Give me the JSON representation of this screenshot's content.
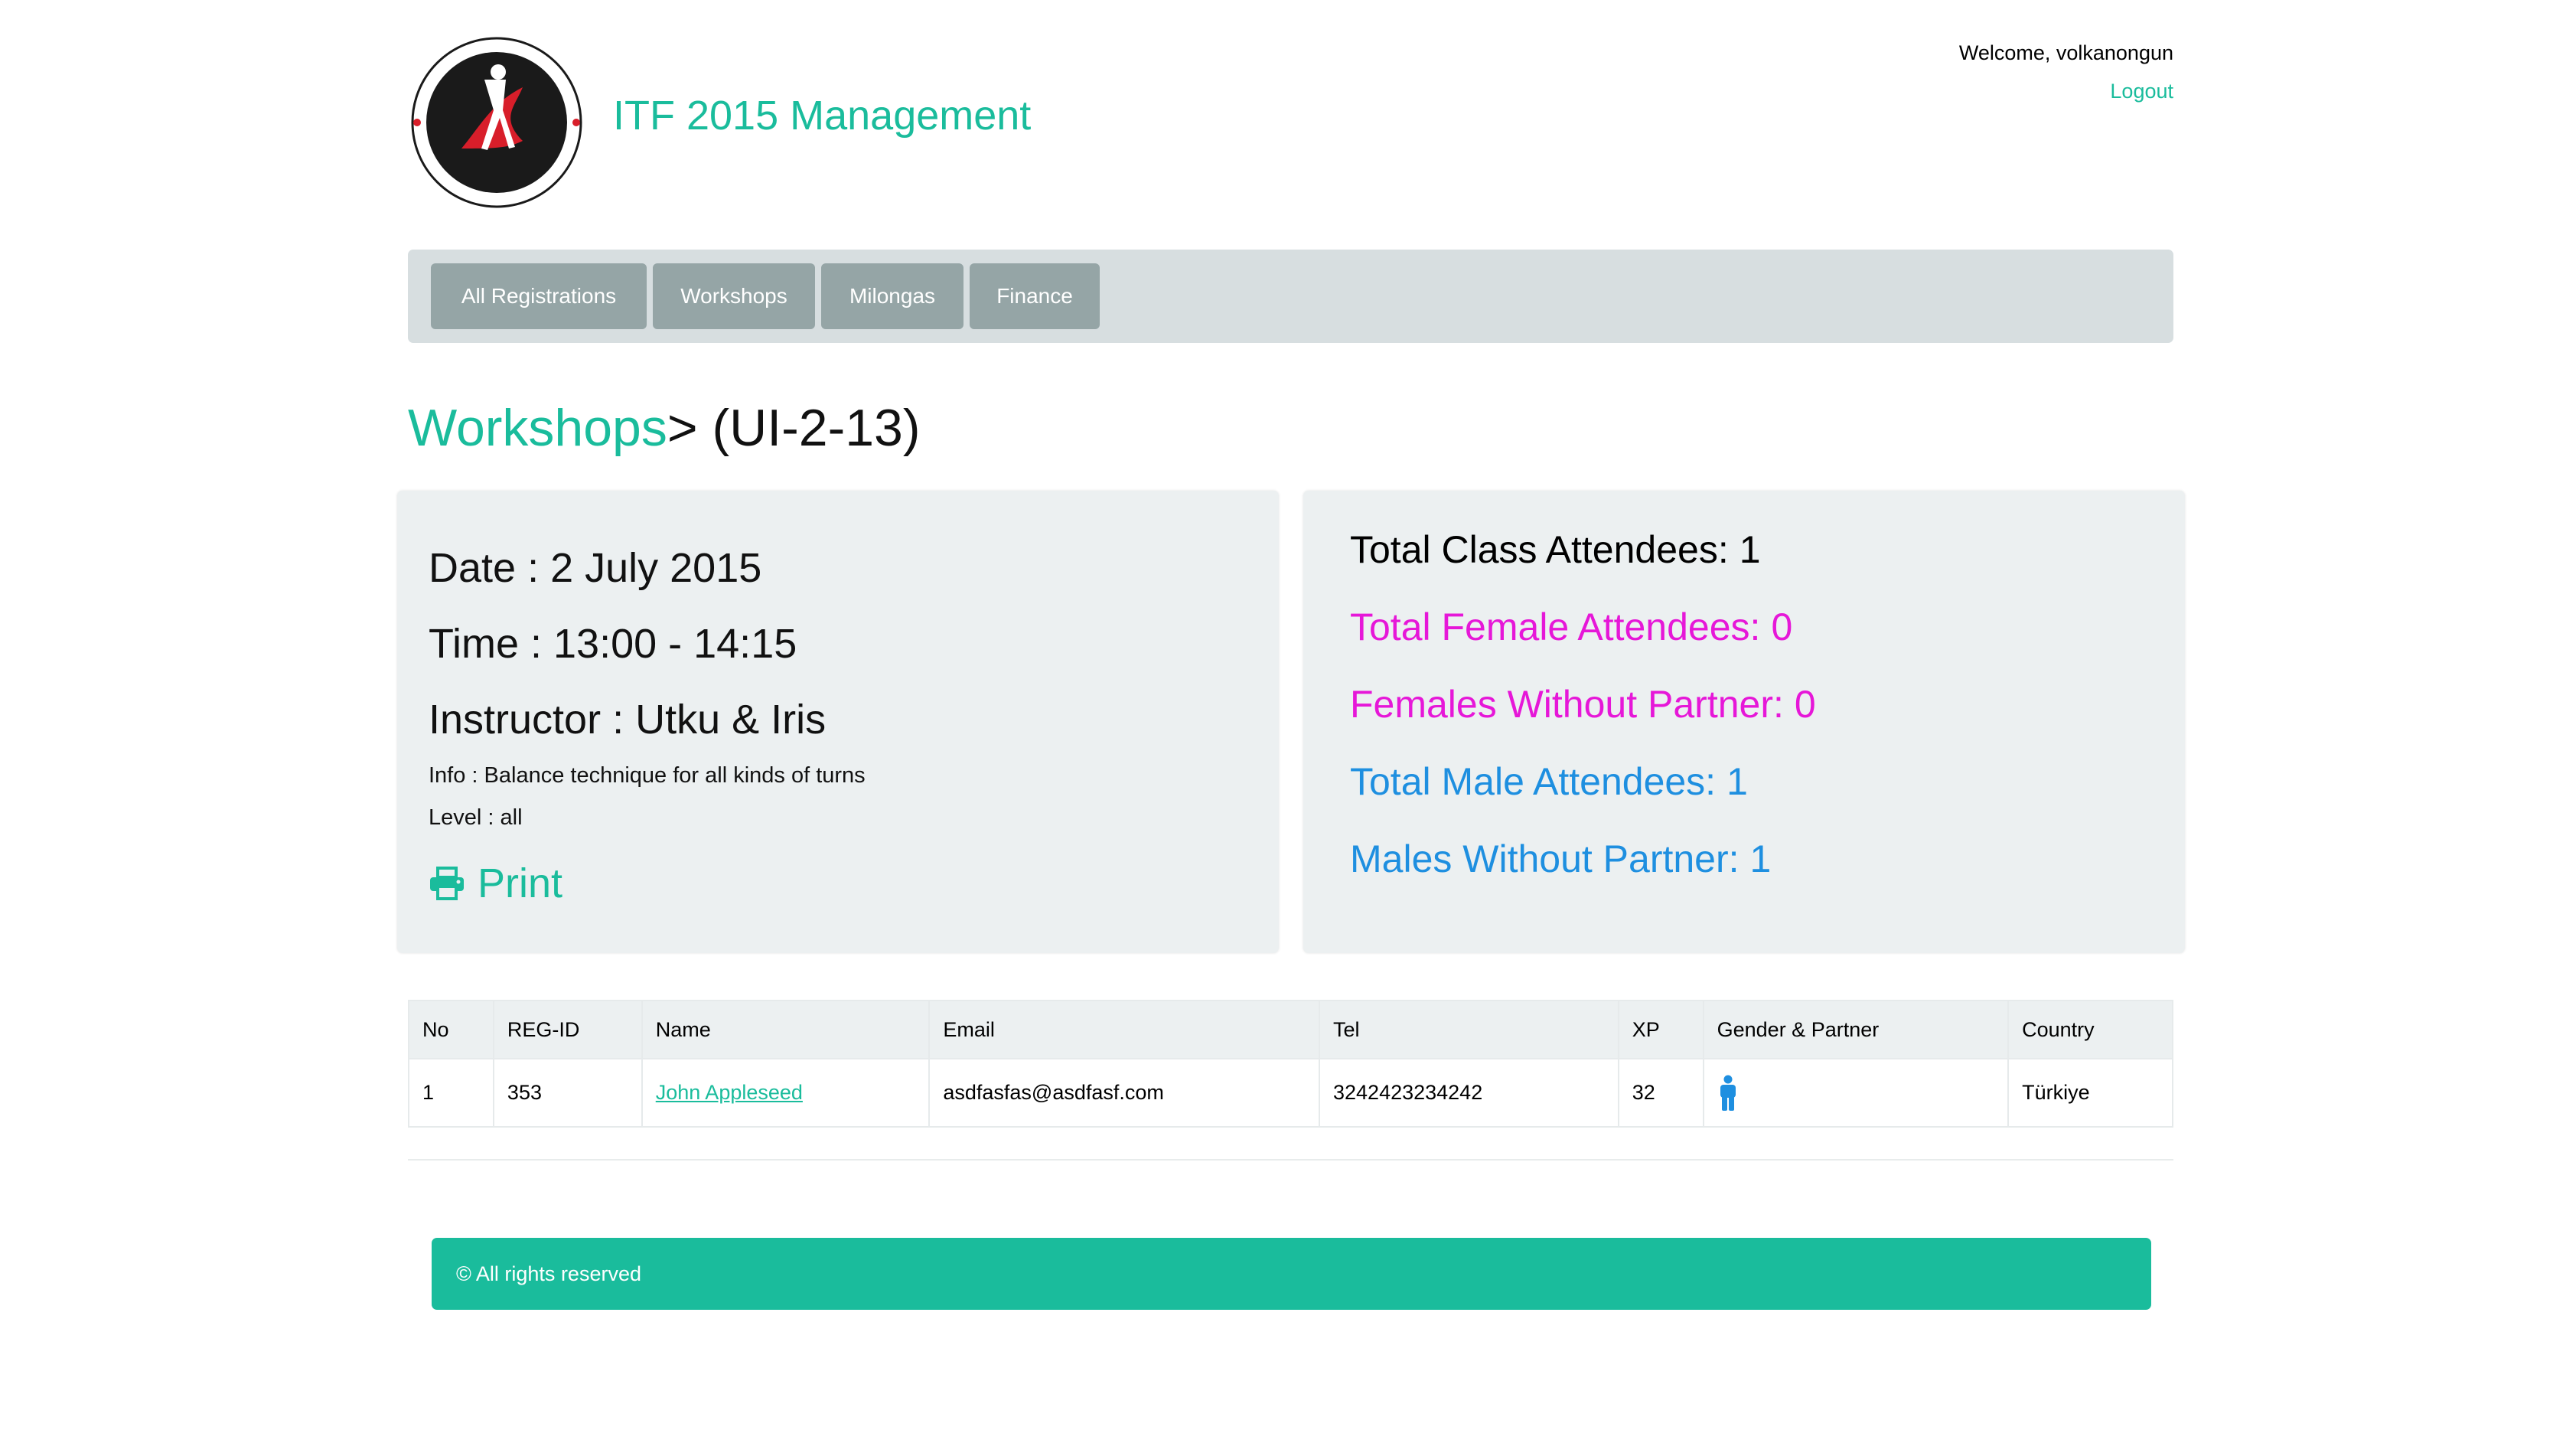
{
  "header": {
    "app_title": "ITF 2015 Management",
    "welcome_text": "Welcome, volkanongun",
    "logout_label": "Logout"
  },
  "nav": {
    "items": [
      {
        "label": "All Registrations"
      },
      {
        "label": "Workshops"
      },
      {
        "label": "Milongas"
      },
      {
        "label": "Finance"
      }
    ]
  },
  "breadcrumb": {
    "link": "Workshops",
    "current": "> (UI-2-13)"
  },
  "details": {
    "date": "Date : 2 July 2015",
    "time": "Time : 13:00 - 14:15",
    "instructor": "Instructor : Utku & Iris",
    "info": "Info : Balance technique for all kinds of turns",
    "level": "Level : all",
    "print_label": "Print"
  },
  "stats": {
    "total_class": {
      "label": "Total Class Attendees:",
      "value": "1",
      "color": "#000000"
    },
    "total_female": {
      "label": "Total Female Attendees:",
      "value": "0",
      "color": "#e617d8"
    },
    "females_without": {
      "label": "Females Without Partner:",
      "value": "0",
      "color": "#e617d8"
    },
    "total_male": {
      "label": "Total Male Attendees:",
      "value": "1",
      "color": "#1e8fe0"
    },
    "males_without": {
      "label": "Males Without Partner:",
      "value": "1",
      "color": "#1e8fe0"
    }
  },
  "table": {
    "columns": [
      "No",
      "REG-ID",
      "Name",
      "Email",
      "Tel",
      "XP",
      "Gender & Partner",
      "Country"
    ],
    "rows": [
      {
        "no": "1",
        "reg_id": "353",
        "name": "John Appleseed",
        "email": "asdfasfas@asdfasf.com",
        "tel": "3242423234242",
        "xp": "32",
        "gender_icon": "male-person-icon",
        "country": "Türkiye"
      }
    ]
  },
  "footer": {
    "copyright": "© All rights reserved"
  },
  "colors": {
    "accent": "#1abc9c",
    "female": "#e617d8",
    "male": "#1e8fe0",
    "nav_button": "#95a5a6",
    "panel": "#ecf0f1"
  }
}
